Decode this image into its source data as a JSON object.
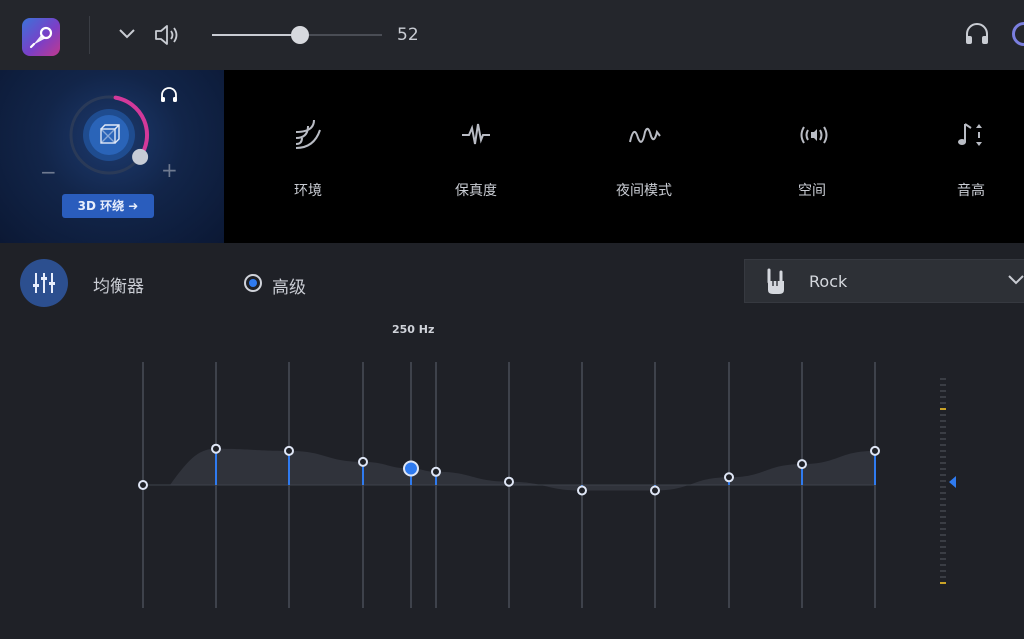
{
  "volume": {
    "value": "52",
    "level": 0.52
  },
  "surround": {
    "button_label": "3D 环绕 ➜",
    "minus": "−",
    "plus": "+",
    "level": 0.72
  },
  "effects": [
    {
      "label": "环境",
      "icon": "ambience-waves-icon"
    },
    {
      "label": "保真度",
      "icon": "fidelity-waveform-icon"
    },
    {
      "label": "夜间模式",
      "icon": "night-mode-wave-icon"
    },
    {
      "label": "空间",
      "icon": "space-speaker-icon"
    },
    {
      "label": "音高",
      "icon": "pitch-note-icon"
    }
  ],
  "equalizer": {
    "label": "均衡器",
    "mode_label": "高级",
    "preset": "Rock",
    "active_band_label": "250 Hz",
    "bands": [
      0,
      0.33,
      0.31,
      0.21,
      0.15,
      0.12,
      0.03,
      -0.05,
      -0.05,
      0.07,
      0.19,
      0.31
    ],
    "active_band_index": 4
  },
  "colors": {
    "accent": "#2f7bf0",
    "band_line": "#3e424b",
    "panel": "#1f2127"
  }
}
